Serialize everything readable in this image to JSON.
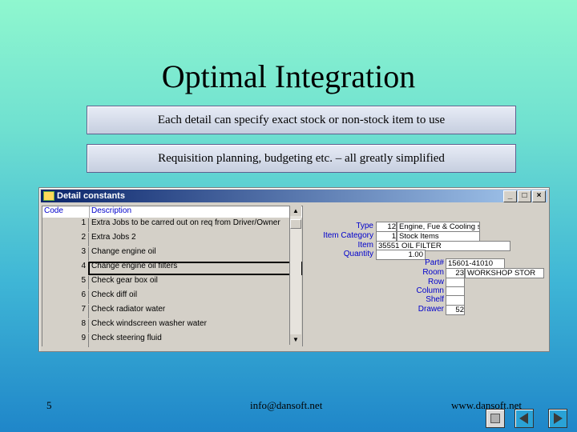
{
  "slide": {
    "title": "Optimal Integration",
    "callouts": [
      "Each detail can specify exact stock or non-stock item to use",
      "Requisition planning, budgeting etc. – all greatly simplified"
    ],
    "footer": {
      "page": "5",
      "email": "info@dansoft.net",
      "web": "www.dansoft.net"
    }
  },
  "window": {
    "title": "Detail constants",
    "buttons": [
      "_",
      "□",
      "×"
    ],
    "list": {
      "headers": [
        "Code",
        "Description"
      ],
      "rows": [
        {
          "code": "1",
          "desc": "Extra Jobs to be carred out on req from Driver/Owner"
        },
        {
          "code": "2",
          "desc": "Extra Jobs 2"
        },
        {
          "code": "3",
          "desc": "Change engine oil"
        },
        {
          "code": "4",
          "desc": "Change engine oil filters"
        },
        {
          "code": "5",
          "desc": "Check gear box oil"
        },
        {
          "code": "6",
          "desc": "Check diff oil"
        },
        {
          "code": "7",
          "desc": "Check radiator water"
        },
        {
          "code": "8",
          "desc": "Check windscreen washer water"
        },
        {
          "code": "9",
          "desc": "Check steering fluid"
        }
      ],
      "selected_index": 3
    },
    "fields": {
      "type_label": "Type",
      "type_code": "12",
      "type_value": "Engine, Fue & Cooling s",
      "category_label": "Item Category",
      "category_code": "1",
      "category_value": "Stock Items",
      "item_label": "Item",
      "item_value": "35551 OIL FILTER",
      "quantity_label": "Quantity",
      "quantity_value": "1.00",
      "part_label": "Part#",
      "part_value": "15601-41010",
      "room_label": "Room",
      "room_code": "23",
      "room_value": "WORKSHOP STOR",
      "row_label": "Row",
      "column_label": "Column",
      "shelf_label": "Shelf",
      "drawer_label": "Drawer",
      "drawer_value": "52"
    }
  },
  "colors": {
    "window_title": "#0a246a",
    "label_text": "#0000cc"
  }
}
